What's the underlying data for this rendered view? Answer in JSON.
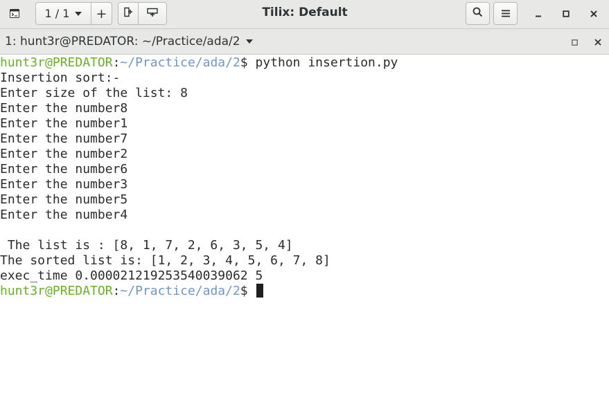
{
  "window": {
    "title": "Tilix: Default",
    "session_counter": "1 / 1",
    "add_label": "+"
  },
  "tab": {
    "title": "1: hunt3r@PREDATOR: ~/Practice/ada/2"
  },
  "terminal": {
    "prompt_user": "hunt3r@PREDATOR",
    "prompt_sep": ":",
    "prompt_path": "~/Practice/ada/2",
    "prompt_symbol": "$ ",
    "command": "python insertion.py",
    "output": [
      "Insertion sort:-",
      "Enter size of the list: 8",
      "Enter the number8",
      "Enter the number1",
      "Enter the number7",
      "Enter the number2",
      "Enter the number6",
      "Enter the number3",
      "Enter the number5",
      "Enter the number4",
      "",
      " The list is : [8, 1, 7, 2, 6, 3, 5, 4]",
      "The sorted list is: [1, 2, 3, 4, 5, 6, 7, 8]",
      "exec_time 0.000021219253540039062 5"
    ]
  },
  "icons": [
    "terminal-app-icon",
    "chevron-down-icon",
    "add-terminal-right-icon",
    "add-terminal-down-icon",
    "search-icon",
    "hamburger-menu-icon",
    "minimize-icon",
    "maximize-icon",
    "close-icon",
    "tab-maximize-icon",
    "tab-close-icon"
  ],
  "colors": {
    "prompt_user": "#65b420",
    "prompt_path": "#6e97c9",
    "chrome_bg": "#e8e8e7"
  }
}
